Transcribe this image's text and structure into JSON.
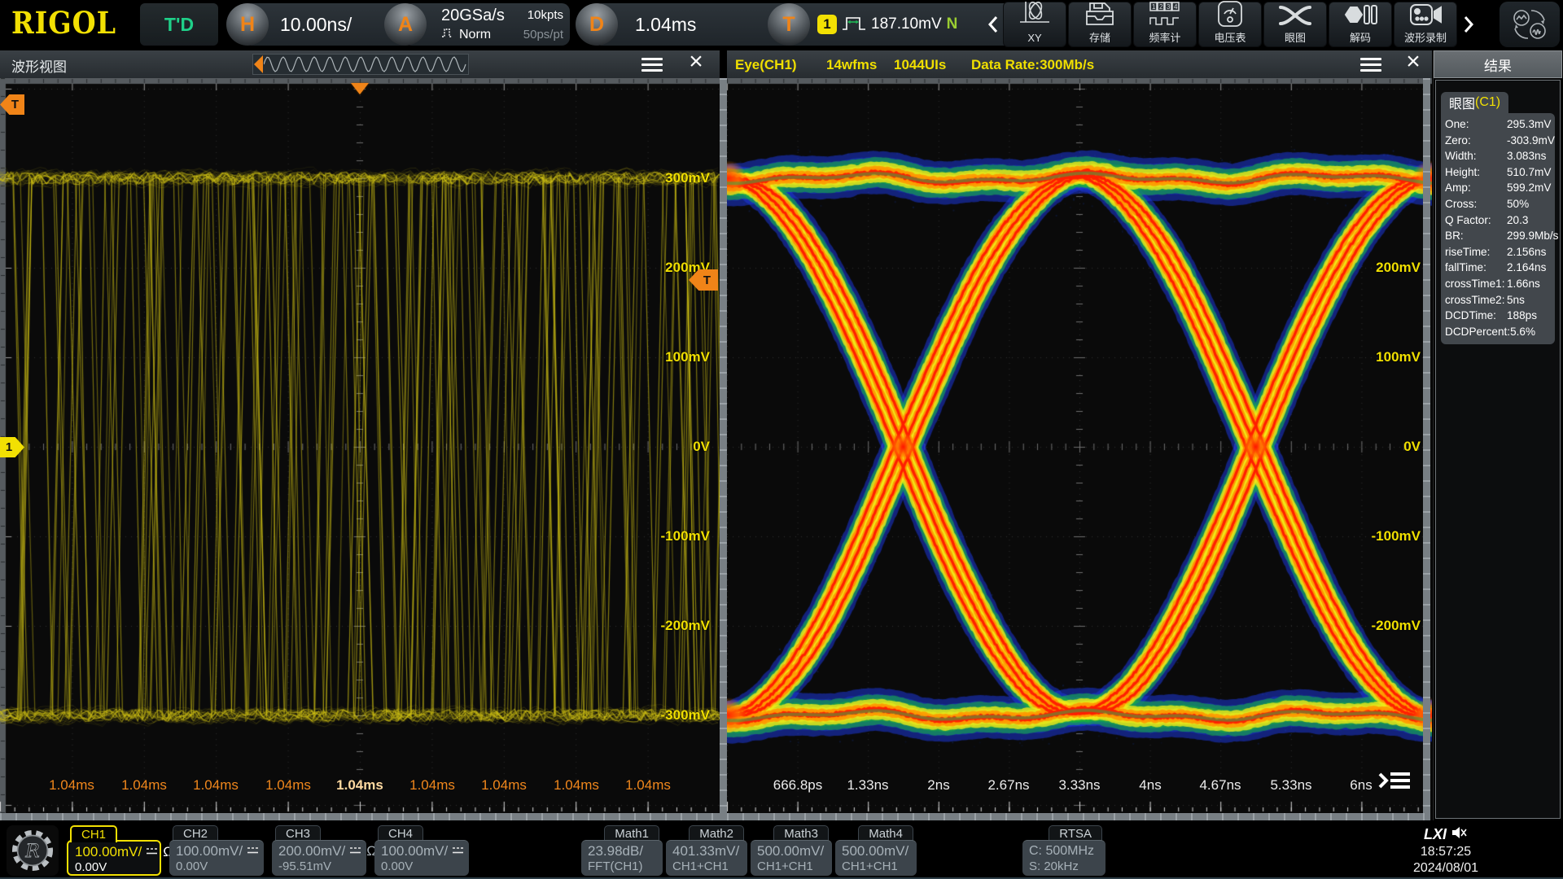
{
  "header": {
    "brand": "RIGOL",
    "trigger_status": "T'D",
    "knob_h": "H",
    "h_scale": "10.00ns/",
    "knob_a": "A",
    "sample_rate": "20GSa/s",
    "mem_depth": "10kpts",
    "acq_mode": "Norm",
    "sample_interval": "50ps/pt",
    "knob_d": "D",
    "delay": "1.04ms",
    "knob_t": "T",
    "trig_channel": "1",
    "trig_level": "187.10mV",
    "trig_mode_flag": "N",
    "toolbar": [
      {
        "id": "xy",
        "label": "XY",
        "icon": "xy-icon"
      },
      {
        "id": "storage",
        "label": "存储",
        "icon": "storage-icon"
      },
      {
        "id": "counter",
        "label": "频率计",
        "icon": "frequency-counter-icon"
      },
      {
        "id": "voltmeter",
        "label": "电压表",
        "icon": "voltmeter-icon"
      },
      {
        "id": "eye",
        "label": "眼图",
        "icon": "eye-diagram-icon"
      },
      {
        "id": "decode",
        "label": "解码",
        "icon": "decode-icon"
      },
      {
        "id": "record",
        "label": "波形录制",
        "icon": "waveform-record-icon"
      }
    ]
  },
  "wave_panel": {
    "title": "波形视图",
    "trigger_time_marker": "T",
    "trigger_level_marker": "T",
    "channel_marker": "1",
    "v_labels": [
      "300mV",
      "200mV",
      "100mV",
      "0V",
      "-100mV",
      "-200mV",
      "-300mV"
    ],
    "t_labels": [
      "1.04ms",
      "1.04ms",
      "1.04ms",
      "1.04ms",
      "1.04ms",
      "1.04ms",
      "1.04ms",
      "1.04ms",
      "1.04ms"
    ]
  },
  "eye_panel": {
    "title": "Eye(CH1)",
    "wfms": "14wfms",
    "uis": "1044UIs",
    "data_rate": "Data Rate:300Mb/s",
    "v_labels": [
      "200mV",
      "100mV",
      "0V",
      "-100mV",
      "-200mV"
    ],
    "t_labels": [
      "666.8ps",
      "1.33ns",
      "2ns",
      "2.67ns",
      "3.33ns",
      "4ns",
      "4.67ns",
      "5.33ns",
      "6ns"
    ]
  },
  "results": {
    "title": "结果",
    "tab_label": "眼图",
    "tab_channel": "(C1)",
    "items": [
      {
        "label": "One:",
        "value": "295.3mV"
      },
      {
        "label": "Zero:",
        "value": "-303.9mV"
      },
      {
        "label": "Width:",
        "value": "3.083ns"
      },
      {
        "label": "Height:",
        "value": "510.7mV"
      },
      {
        "label": "Amp:",
        "value": "599.2mV"
      },
      {
        "label": "Cross:",
        "value": "50%"
      },
      {
        "label": "Q Factor:",
        "value": "20.3"
      },
      {
        "label": "BR:",
        "value": "299.9Mb/s"
      },
      {
        "label": "riseTime:",
        "value": "2.156ns"
      },
      {
        "label": "fallTime:",
        "value": "2.164ns"
      },
      {
        "label": "crossTime1:",
        "value": "1.66ns"
      },
      {
        "label": "crossTime2:",
        "value": "5ns"
      },
      {
        "label": "DCDTime:",
        "value": "188ps"
      },
      {
        "label": "DCDPercent:",
        "value": "5.6%"
      }
    ]
  },
  "bottom": {
    "channels": [
      {
        "name": "CH1",
        "scale": "100.00mV/",
        "impedance": "Ω",
        "offset": "0.00V",
        "active": true
      },
      {
        "name": "CH2",
        "scale": "100.00mV/",
        "impedance": "",
        "offset": "0.00V",
        "active": false
      },
      {
        "name": "CH3",
        "scale": "200.00mV/",
        "impedance": "Ω",
        "offset": "-95.51mV",
        "active": false
      },
      {
        "name": "CH4",
        "scale": "100.00mV/",
        "impedance": "",
        "offset": "0.00V",
        "active": false
      }
    ],
    "maths": [
      {
        "name": "Math1",
        "scale": "23.98dB/",
        "source": "FFT(CH1)"
      },
      {
        "name": "Math2",
        "scale": "401.33mV/",
        "source": "CH1+CH1"
      },
      {
        "name": "Math3",
        "scale": "500.00mV/",
        "source": "CH1+CH1"
      },
      {
        "name": "Math4",
        "scale": "500.00mV/",
        "source": "CH1+CH1"
      }
    ],
    "rtsa": {
      "name": "RTSA",
      "center": "C: 500MHz",
      "span": "S: 20kHz"
    },
    "status": {
      "lxi": "LXI",
      "time": "18:57:25",
      "date": "2024/08/01"
    }
  },
  "colors": {
    "accent_yellow": "#f2e003",
    "accent_orange": "#f08418",
    "trig_green": "#1fd089",
    "trace_yellow": "#d6c714"
  },
  "chart_data": [
    {
      "id": "waveform-view",
      "type": "line",
      "title": "波形视图",
      "x_tick_labels": [
        "1.04ms",
        "1.04ms",
        "1.04ms",
        "1.04ms",
        "1.04ms",
        "1.04ms",
        "1.04ms",
        "1.04ms",
        "1.04ms"
      ],
      "y_tick_labels": [
        "300mV",
        "200mV",
        "100mV",
        "0V",
        "-100mV",
        "-200mV",
        "-300mV"
      ],
      "x_divisions": 10,
      "y_divisions": 8,
      "timebase_per_div": "10.00ns",
      "volts_per_div": "100.00mV",
      "grid": "dotted",
      "series": [
        {
          "name": "CH1",
          "kind": "NRZ random data, persistence overlay",
          "high_level": "295.3mV",
          "low_level": "-303.9mV",
          "bit_rate": "300Mb/s",
          "color": "#d6c714"
        }
      ]
    },
    {
      "id": "eye-diagram",
      "type": "heatmap",
      "title": "Eye(CH1)",
      "x_tick_labels": [
        "666.8ps",
        "1.33ns",
        "2ns",
        "2.67ns",
        "3.33ns",
        "4ns",
        "4.67ns",
        "5.33ns",
        "6ns"
      ],
      "y_tick_labels": [
        "200mV",
        "100mV",
        "0V",
        "-100mV",
        "-200mV"
      ],
      "one_level": "295.3mV",
      "zero_level": "-303.9mV",
      "eye_width": "3.083ns",
      "eye_height": "510.7mV",
      "amplitude": "599.2mV",
      "crossing_percent": "50%",
      "q_factor": "20.3",
      "bit_rate": "299.9Mb/s",
      "rise_time": "2.156ns",
      "fall_time": "2.164ns",
      "cross_times": [
        "1.66ns",
        "5ns"
      ],
      "dcd_time": "188ps",
      "dcd_percent": "5.6%",
      "colormap": "jet (blue-green-yellow-orange-red by density)"
    }
  ]
}
